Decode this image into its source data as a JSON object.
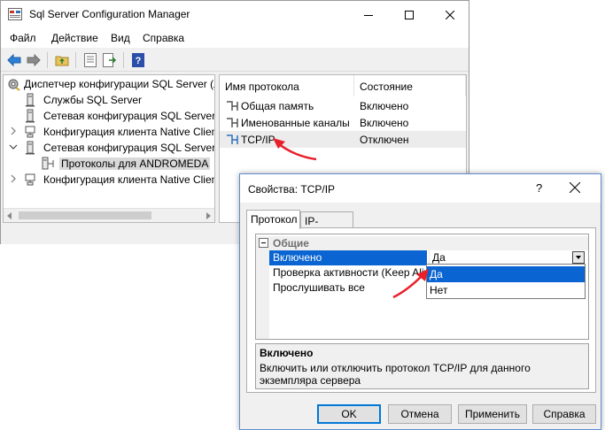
{
  "main_window": {
    "title": "Sql Server Configuration Manager",
    "menu": [
      "Файл",
      "Действие",
      "Вид",
      "Справка"
    ],
    "tree": [
      {
        "label": "Диспетчер конфигурации SQL Server (Л"
      },
      {
        "label": "Службы SQL Server"
      },
      {
        "label": "Сетевая конфигурация SQL Server (3"
      },
      {
        "label": "Конфигурация клиента Native Clien"
      },
      {
        "label": "Сетевая конфигурация SQL Server"
      },
      {
        "label": "Протоколы для ANDROMEDA"
      },
      {
        "label": "Конфигурация клиента Native Clien"
      }
    ],
    "list": {
      "columns": [
        "Имя протокола",
        "Состояние"
      ],
      "rows": [
        {
          "name": "Общая память",
          "state": "Включено"
        },
        {
          "name": "Именованные каналы",
          "state": "Включено"
        },
        {
          "name": "TCP/IP",
          "state": "Отключен"
        }
      ]
    }
  },
  "dialog": {
    "title": "Свойства: TCP/IP",
    "help": "?",
    "tabs": [
      "Протокол",
      "IP-адреса"
    ],
    "section": "Общие",
    "properties": [
      {
        "name": "Включено",
        "value": "Да"
      },
      {
        "name": "Проверка активности (Keep Alive",
        "value": ""
      },
      {
        "name": "Прослушивать все",
        "value": ""
      }
    ],
    "dropdown_options": [
      "Да",
      "Нет"
    ],
    "description": {
      "title": "Включено",
      "text": "Включить или отключить протокол TCP/IP для данного экземпляра сервера"
    },
    "buttons": [
      "OK",
      "Отмена",
      "Применить",
      "Справка"
    ]
  },
  "colors": {
    "selection": "#0a64d1",
    "arrow": "#e8202a",
    "dialog_border": "#5f8fcf"
  }
}
